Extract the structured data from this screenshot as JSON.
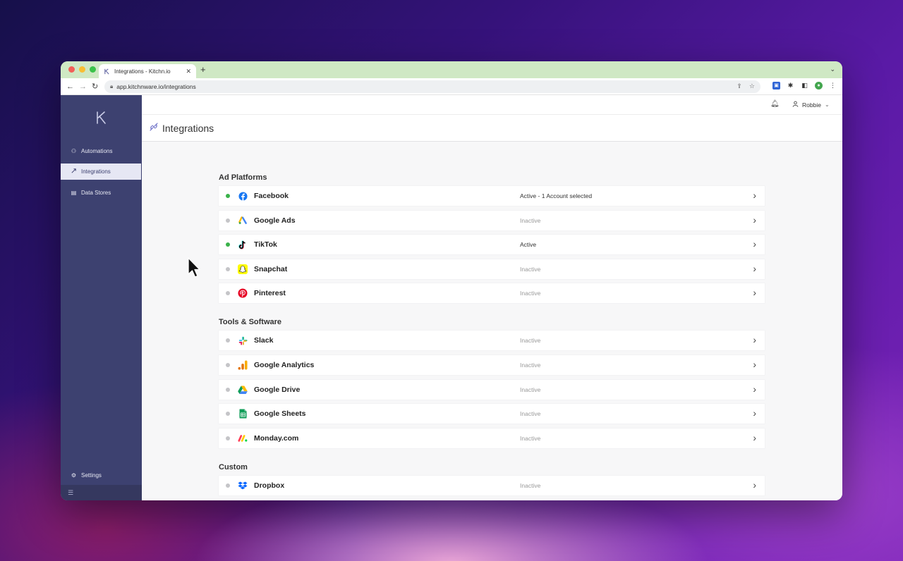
{
  "browser": {
    "tab_title": "Integrations - Kitchn.io",
    "url": "app.kitchnware.io/integrations"
  },
  "sidebar": {
    "items": [
      {
        "label": "Automations",
        "icon": "automations-icon"
      },
      {
        "label": "Integrations",
        "icon": "integrations-icon",
        "active": true
      },
      {
        "label": "Data Stores",
        "icon": "database-icon"
      }
    ],
    "settings_label": "Settings"
  },
  "topbar": {
    "user_name": "Robbie"
  },
  "page": {
    "title": "Integrations"
  },
  "sections": [
    {
      "title": "Ad Platforms",
      "items": [
        {
          "name": "Facebook",
          "status": "Active - 1 Account selected",
          "active": true,
          "icon": "facebook-icon"
        },
        {
          "name": "Google Ads",
          "status": "Inactive",
          "active": false,
          "icon": "google-ads-icon"
        },
        {
          "name": "TikTok",
          "status": "Active",
          "active": true,
          "icon": "tiktok-icon"
        },
        {
          "name": "Snapchat",
          "status": "Inactive",
          "active": false,
          "icon": "snapchat-icon"
        },
        {
          "name": "Pinterest",
          "status": "Inactive",
          "active": false,
          "icon": "pinterest-icon"
        }
      ]
    },
    {
      "title": "Tools & Software",
      "items": [
        {
          "name": "Slack",
          "status": "Inactive",
          "active": false,
          "icon": "slack-icon"
        },
        {
          "name": "Google Analytics",
          "status": "Inactive",
          "active": false,
          "icon": "google-analytics-icon"
        },
        {
          "name": "Google Drive",
          "status": "Inactive",
          "active": false,
          "icon": "google-drive-icon"
        },
        {
          "name": "Google Sheets",
          "status": "Inactive",
          "active": false,
          "icon": "google-sheets-icon"
        },
        {
          "name": "Monday.com",
          "status": "Inactive",
          "active": false,
          "icon": "monday-icon"
        }
      ]
    },
    {
      "title": "Custom",
      "items": [
        {
          "name": "Dropbox",
          "status": "Inactive",
          "active": false,
          "icon": "dropbox-icon"
        }
      ]
    }
  ],
  "colors": {
    "sidebar_bg": "#3d4170",
    "active_dot": "#3ab24a",
    "inactive_dot": "#c5c5c8",
    "tabbar_bg": "#cfe8c4"
  }
}
